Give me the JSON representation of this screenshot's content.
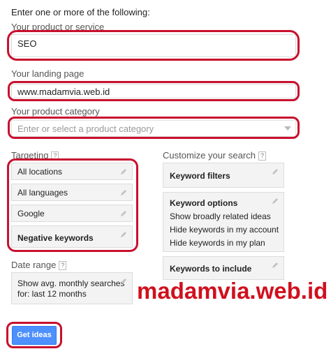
{
  "form": {
    "header": "Enter one or more of the following:",
    "product": {
      "label": "Your product or service",
      "value": "SEO"
    },
    "landing": {
      "label": "Your landing page",
      "value": "www.madamvia.web.id"
    },
    "category": {
      "label": "Your product category",
      "placeholder": "Enter or select a product category"
    }
  },
  "targeting": {
    "label": "Targeting",
    "help": "?",
    "items": [
      {
        "label": "All locations"
      },
      {
        "label": "All languages"
      },
      {
        "label": "Google"
      },
      {
        "label": "Negative keywords"
      }
    ]
  },
  "customize": {
    "label": "Customize your search",
    "help": "?",
    "keyword_filters": "Keyword filters",
    "keyword_options": {
      "title": "Keyword options",
      "lines": [
        "Show broadly related ideas",
        "Hide keywords in my account",
        "Hide keywords in my plan"
      ]
    },
    "keywords_to_include": "Keywords to include"
  },
  "date_range": {
    "label": "Date range",
    "help": "?",
    "text_line1": "Show avg. monthly searches",
    "text_line2": "for: last 12 months"
  },
  "watermark": "madamvia.web.id",
  "button": {
    "label": "Get ideas",
    "color": "#4d90fe"
  },
  "colors": {
    "annotation": "#c8102e",
    "watermark": "#d0101e"
  }
}
